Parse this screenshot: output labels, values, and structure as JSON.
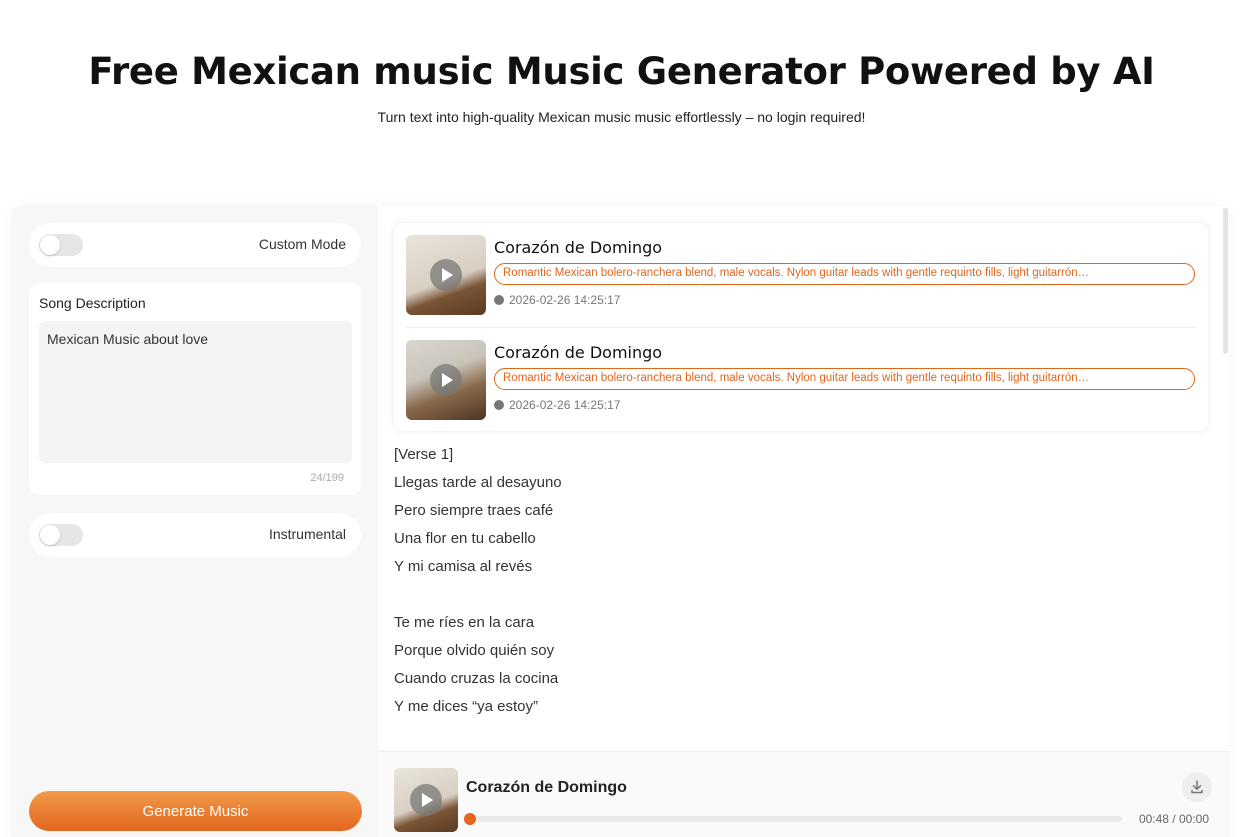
{
  "header": {
    "title": "Free Mexican music Music Generator Powered by AI",
    "subtitle": "Turn text into high-quality Mexican music music effortlessly – no login required!"
  },
  "form": {
    "custom_mode_label": "Custom Mode",
    "custom_mode_on": false,
    "description_title": "Song Description",
    "description_value": "Mexican Music about love",
    "description_count": "24/199",
    "instrumental_label": "Instrumental",
    "instrumental_on": false,
    "generate_label": "Generate Music"
  },
  "songs": [
    {
      "title": "Corazón de Domingo",
      "tag": "Romantic Mexican bolero-ranchera blend, male vocals. Nylon guitar leads with gentle requinto fills, light guitarrón…",
      "date": "2026-02-26 14:25:17"
    },
    {
      "title": "Corazón de Domingo",
      "tag": "Romantic Mexican bolero-ranchera blend, male vocals. Nylon guitar leads with gentle requinto fills, light guitarrón…",
      "date": "2026-02-26 14:25:17"
    }
  ],
  "lyrics": [
    "[Verse 1]",
    "Llegas tarde al desayuno",
    "Pero siempre traes café",
    "Una flor en tu cabello",
    "Y mi camisa al revés",
    "",
    "Te me ríes en la cara",
    "Porque olvido quién soy",
    "Cuando cruzas la cocina",
    "Y me dices “ya estoy”"
  ],
  "player": {
    "title": "Corazón de Domingo",
    "time": "00:48 / 00:00",
    "progress": 0
  },
  "colors": {
    "accent": "#e2661d",
    "accent_light": "#f29a4a"
  },
  "icons": {
    "play": "play-icon",
    "clock": "clock-icon",
    "download": "download-icon"
  }
}
